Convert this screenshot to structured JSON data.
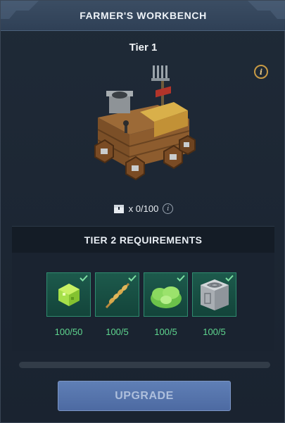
{
  "header": {
    "title": "FARMER'S WORKBENCH"
  },
  "tier": {
    "title": "Tier 1"
  },
  "storage": {
    "icon": "chest-icon",
    "count": "x 0/100"
  },
  "requirements": {
    "title": "TIER 2 REQUIREMENTS",
    "items": [
      {
        "icon": "slime-cube-icon",
        "amount": "100/50",
        "met": true
      },
      {
        "icon": "wheat-icon",
        "amount": "100/5",
        "met": true
      },
      {
        "icon": "lettuce-icon",
        "amount": "100/5",
        "met": true
      },
      {
        "icon": "stone-block-icon",
        "amount": "100/5",
        "met": true
      }
    ]
  },
  "progress": {
    "fraction": 0.0
  },
  "upgrade": {
    "label": "UPGRADE"
  },
  "colors": {
    "header_bg": "#34475e",
    "panel_bg": "#1d2734",
    "slot_bg": "#1a5346",
    "amount_green": "#5fd68f",
    "info_gold": "#c79a45",
    "button_blue": "#5874ab"
  }
}
